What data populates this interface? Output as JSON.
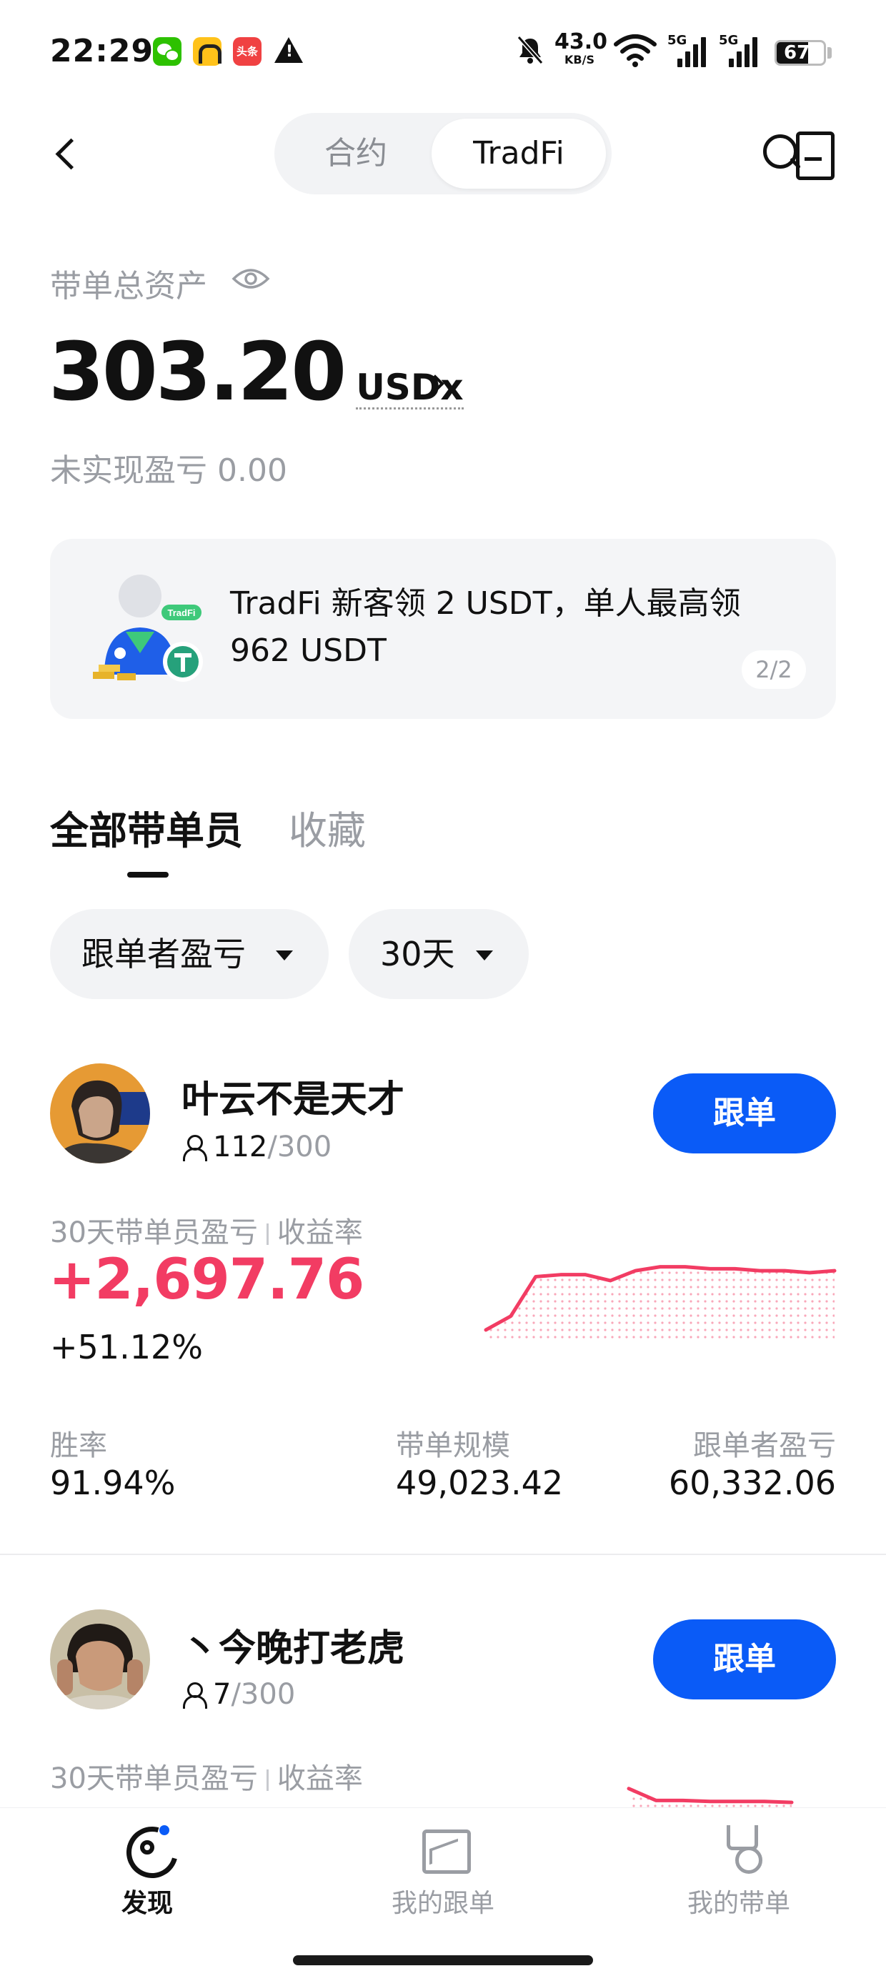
{
  "status_bar": {
    "time": "22:29",
    "net_speed": "43.0",
    "net_unit": "KB/S",
    "sim1": "5G",
    "sim2": "5G",
    "battery": "67",
    "toutiao_label": "头条"
  },
  "header": {
    "tabs": [
      {
        "label": "合约",
        "active": false
      },
      {
        "label": "TradFi",
        "active": true
      }
    ]
  },
  "assets": {
    "label": "带单总资产",
    "value": "303.20",
    "unit": "USDx",
    "unrealized_label": "未实现盈亏",
    "unrealized_value": "0.00"
  },
  "banner": {
    "text": "TradFi 新客领 2 USDT，单人最高领 962 USDT",
    "page": "2/2",
    "illustration_badge": "TradFi"
  },
  "content_tabs": [
    {
      "label": "全部带单员",
      "active": true
    },
    {
      "label": "收藏",
      "active": false
    }
  ],
  "filters": [
    {
      "label": "跟单者盈亏"
    },
    {
      "label": "30天"
    }
  ],
  "traders": [
    {
      "name": "叶云不是天才",
      "followers": "112",
      "max_followers": "/300",
      "follow_label": "跟单",
      "pnl_label": "30天带单员盈亏",
      "roi_label": "收益率",
      "pnl": "+2,697.76",
      "roi": "+51.12%",
      "sparkline": [
        0.08,
        0.22,
        0.62,
        0.64,
        0.64,
        0.58,
        0.68,
        0.72,
        0.72,
        0.7,
        0.7,
        0.68,
        0.68,
        0.66,
        0.68
      ],
      "stats": [
        {
          "label": "胜率",
          "value": "91.94%"
        },
        {
          "label": "带单规模",
          "value": "49,023.42"
        },
        {
          "label": "跟单者盈亏",
          "value": "60,332.06"
        }
      ]
    },
    {
      "name": "丶今晚打老虎",
      "followers": "7",
      "max_followers": "/300",
      "follow_label": "跟单",
      "pnl_label": "30天带单员盈亏",
      "roi_label": "收益率",
      "sparkline": [
        0.98,
        0.86,
        0.86,
        0.85,
        0.85,
        0.85,
        0.84
      ]
    }
  ],
  "bottom_nav": [
    {
      "label": "发现",
      "active": true
    },
    {
      "label": "我的跟单",
      "active": false
    },
    {
      "label": "我的带单",
      "active": false
    }
  ],
  "colors": {
    "accent": "#0a5bf7",
    "profit": "#f23c63",
    "muted": "#9a9da3"
  }
}
